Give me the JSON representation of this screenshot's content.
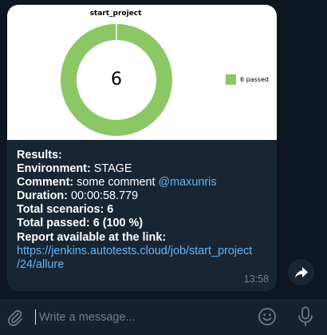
{
  "chart": {
    "title": "start_project",
    "center_value": "6",
    "legend_label": "6 passed",
    "color": "#8cc765"
  },
  "chart_data": {
    "type": "pie",
    "title": "start_project",
    "categories": [
      "passed"
    ],
    "values": [
      6
    ],
    "colors": [
      "#8cc765"
    ],
    "donut": true,
    "center_label": "6",
    "legend_placement": "right"
  },
  "message": {
    "results_label": "Results:",
    "environment_label": "Environment:",
    "environment_value": "STAGE",
    "comment_label": "Comment:",
    "comment_value": "some comment",
    "mention": "@maxunris",
    "duration_label": "Duration:",
    "duration_value": "00:00:58.779",
    "total_scenarios_label": "Total scenarios:",
    "total_scenarios_value": "6",
    "total_passed_label": "Total passed:",
    "total_passed_value": "6 (100 %)",
    "report_label": "Report available at the link:",
    "link_line1": "https://jenkins.autotests.cloud/job/start_project",
    "link_line2": "/24/allure",
    "time": "13:58"
  },
  "composer": {
    "placeholder": "Write a message..."
  },
  "icons": {
    "share": "share-arrow-icon",
    "attach": "paperclip-icon",
    "emoji": "smiley-icon",
    "mic": "microphone-icon"
  },
  "colors": {
    "background": "#0e1621",
    "bubble": "#182533",
    "link": "#6ab3f3",
    "time": "#6d7f8f",
    "composer": "#17212b"
  }
}
